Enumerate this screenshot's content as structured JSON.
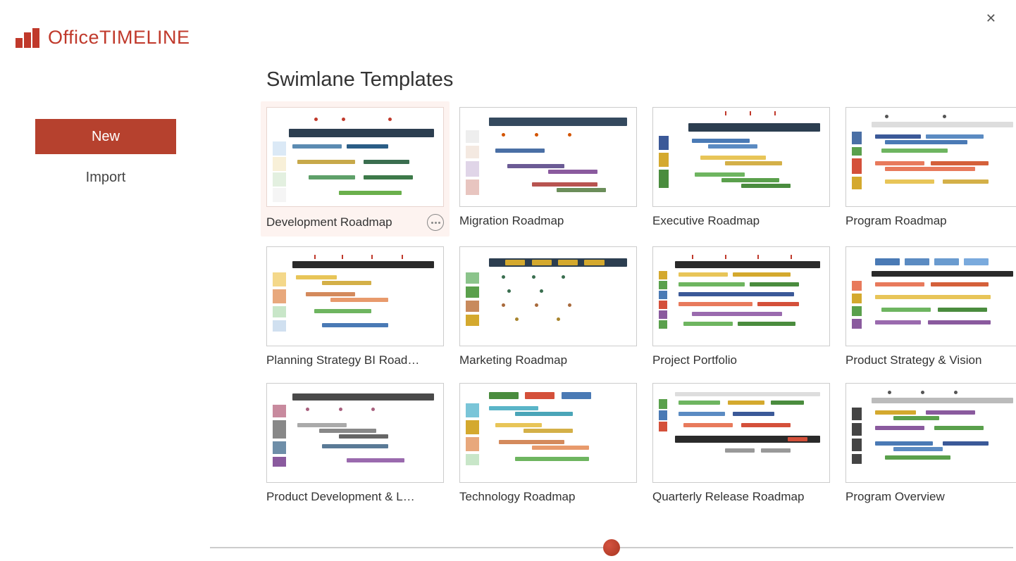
{
  "brand": {
    "first": "Office",
    "second": "TIMELINE"
  },
  "sidebar": {
    "new_label": "New",
    "import_label": "Import"
  },
  "main": {
    "title": "Swimlane Templates"
  },
  "templates": [
    {
      "label": "Development Roadmap",
      "selected": true
    },
    {
      "label": "Migration Roadmap"
    },
    {
      "label": "Executive Roadmap"
    },
    {
      "label": "Program Roadmap"
    },
    {
      "label": "Planning Strategy BI Roadm…"
    },
    {
      "label": "Marketing Roadmap"
    },
    {
      "label": "Project Portfolio"
    },
    {
      "label": "Product Strategy & Vision"
    },
    {
      "label": "Product Development & La…"
    },
    {
      "label": "Technology Roadmap"
    },
    {
      "label": "Quarterly Release Roadmap"
    },
    {
      "label": "Program Overview"
    }
  ]
}
